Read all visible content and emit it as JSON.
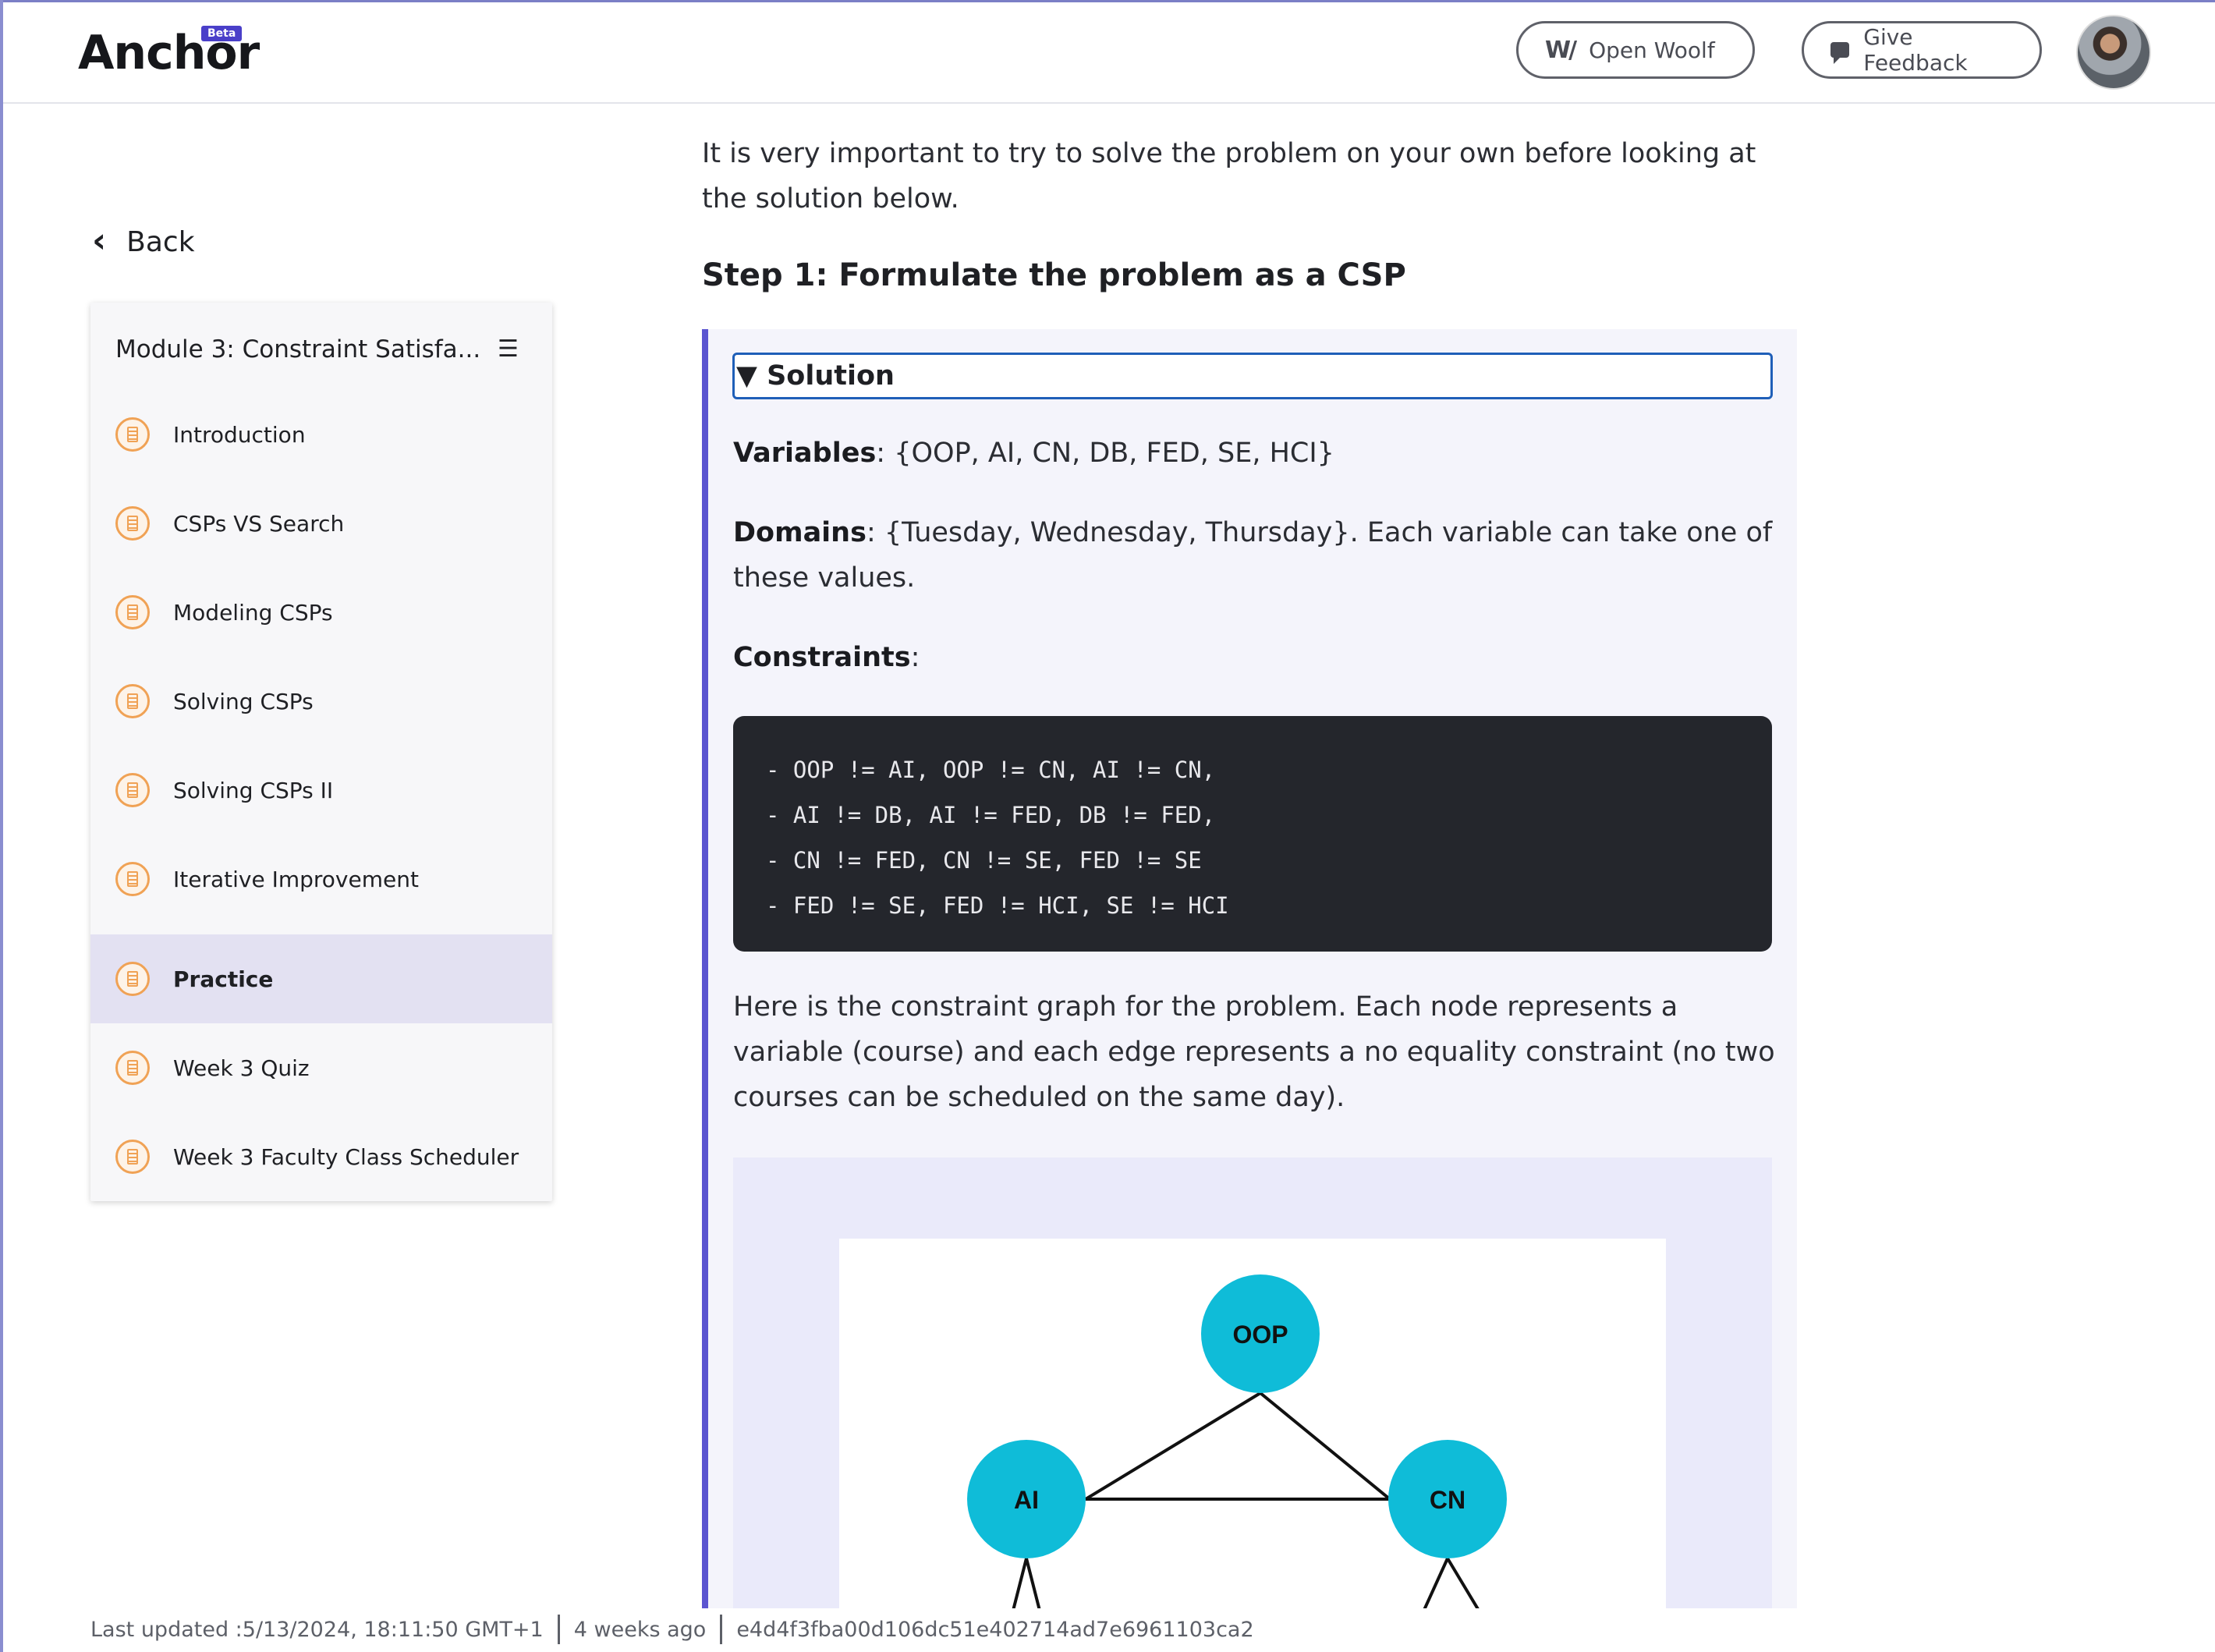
{
  "app": {
    "logo": "Anchor",
    "beta_badge": "Beta"
  },
  "header": {
    "open_woolf_label": "Open Woolf",
    "give_feedback_label": "Give Feedback"
  },
  "sidebar": {
    "back_label": "Back",
    "module_title": "Module 3: Constraint Satisfa...",
    "items": [
      {
        "label": "Introduction",
        "active": false
      },
      {
        "label": "CSPs VS Search",
        "active": false
      },
      {
        "label": "Modeling CSPs",
        "active": false
      },
      {
        "label": "Solving CSPs",
        "active": false
      },
      {
        "label": "Solving CSPs II",
        "active": false
      },
      {
        "label": "Iterative Improvement",
        "active": false
      },
      {
        "label": "Practice",
        "active": true
      },
      {
        "label": "Week 3 Quiz",
        "active": false
      },
      {
        "label": "Week 3 Faculty Class Scheduler",
        "active": false
      }
    ]
  },
  "main": {
    "intro": "It is very important to try to solve the problem on your own before looking at the solution below.",
    "step_title": "Step 1: Formulate the problem as a CSP",
    "solution": {
      "summary_label": "▼ Solution",
      "variables_label": "Variables",
      "variables_value": ": {OOP, AI, CN, DB, FED, SE, HCI}",
      "domains_label": "Domains",
      "domains_value": ": {Tuesday, Wednesday, Thursday}. Each variable can take one of these values.",
      "constraints_label": "Constraints",
      "constraints_suffix": ":",
      "code_lines": [
        "- OOP != AI, OOP != CN, AI != CN,",
        "- AI != DB, AI != FED, DB != FED,",
        "- CN != FED, CN != SE, FED != SE",
        "- FED != SE, FED != HCI, SE != HCI"
      ],
      "graph_description": "Here is the constraint graph for the problem. Each node represents a variable (course) and each edge represents a no equality constraint (no two courses can be scheduled on the same day).",
      "graph_nodes": [
        "OOP",
        "AI",
        "CN"
      ]
    }
  },
  "footer": {
    "last_updated": "Last updated :5/13/2024, 18:11:50 GMT+1",
    "relative": "4 weeks ago",
    "hash": "e4d4f3fba00d106dc51e402714ad7e6961103ca2"
  },
  "colors": {
    "accent": "#5b55d0",
    "node_fill": "#0fbcd8",
    "icon_orange": "#f0a255",
    "active_bg": "#e3e1f2",
    "code_bg": "#24262c"
  }
}
